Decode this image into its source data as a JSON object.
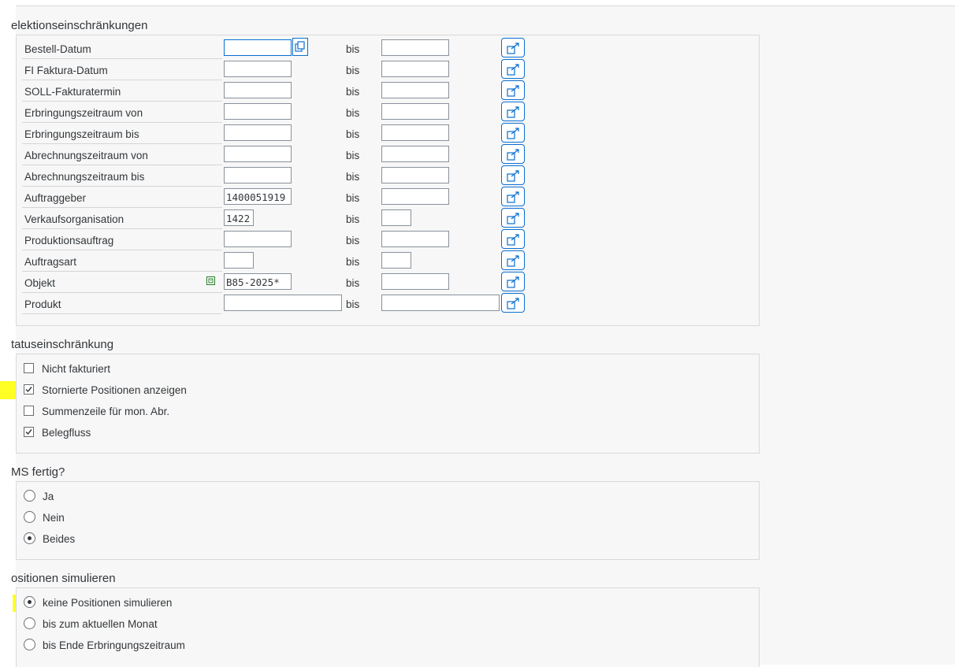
{
  "sections": {
    "selection_title": "elektionseinschränkungen",
    "status_title": "tatuseinschränkung",
    "ims_title": "MS fertig?",
    "positions_title": "ositionen simulieren"
  },
  "bis_label": "bis",
  "selection_rows": [
    {
      "label": "Bestell-Datum",
      "value": ""
    },
    {
      "label": "FI Faktura-Datum",
      "value": ""
    },
    {
      "label": "SOLL-Fakturatermin",
      "value": ""
    },
    {
      "label": "Erbringungszeitraum von",
      "value": ""
    },
    {
      "label": "Erbringungszeitraum bis",
      "value": ""
    },
    {
      "label": "Abrechnungszeitraum von",
      "value": ""
    },
    {
      "label": "Abrechnungszeitraum bis",
      "value": ""
    },
    {
      "label": "Auftraggeber",
      "value": "1400051919"
    },
    {
      "label": "Verkaufsorganisation",
      "value": "1422"
    },
    {
      "label": "Produktionsauftrag",
      "value": ""
    },
    {
      "label": "Auftragsart",
      "value": ""
    },
    {
      "label": "Objekt",
      "value": "B85-2025*"
    },
    {
      "label": "Produkt",
      "value": ""
    }
  ],
  "status_options": [
    {
      "label": "Nicht fakturiert",
      "checked": false
    },
    {
      "label": "Stornierte Positionen anzeigen",
      "checked": true
    },
    {
      "label": "Summenzeile für mon. Abr.",
      "checked": false
    },
    {
      "label": "Belegfluss",
      "checked": true
    }
  ],
  "ims_options": [
    {
      "label": "Ja",
      "selected": false
    },
    {
      "label": "Nein",
      "selected": false
    },
    {
      "label": "Beides",
      "selected": true
    }
  ],
  "position_options": [
    {
      "label": "keine Positionen simulieren",
      "selected": true
    },
    {
      "label": "bis zum aktuellen Monat",
      "selected": false
    },
    {
      "label": "bis Ende Erbringungszeitraum",
      "selected": false
    }
  ],
  "icons": {
    "multi_select": "multiple-selection-icon",
    "copy": "copy-icon",
    "value_help": "value-help-icon"
  },
  "colors": {
    "accent": "#0a6ed1",
    "highlight": "#ffff00"
  }
}
